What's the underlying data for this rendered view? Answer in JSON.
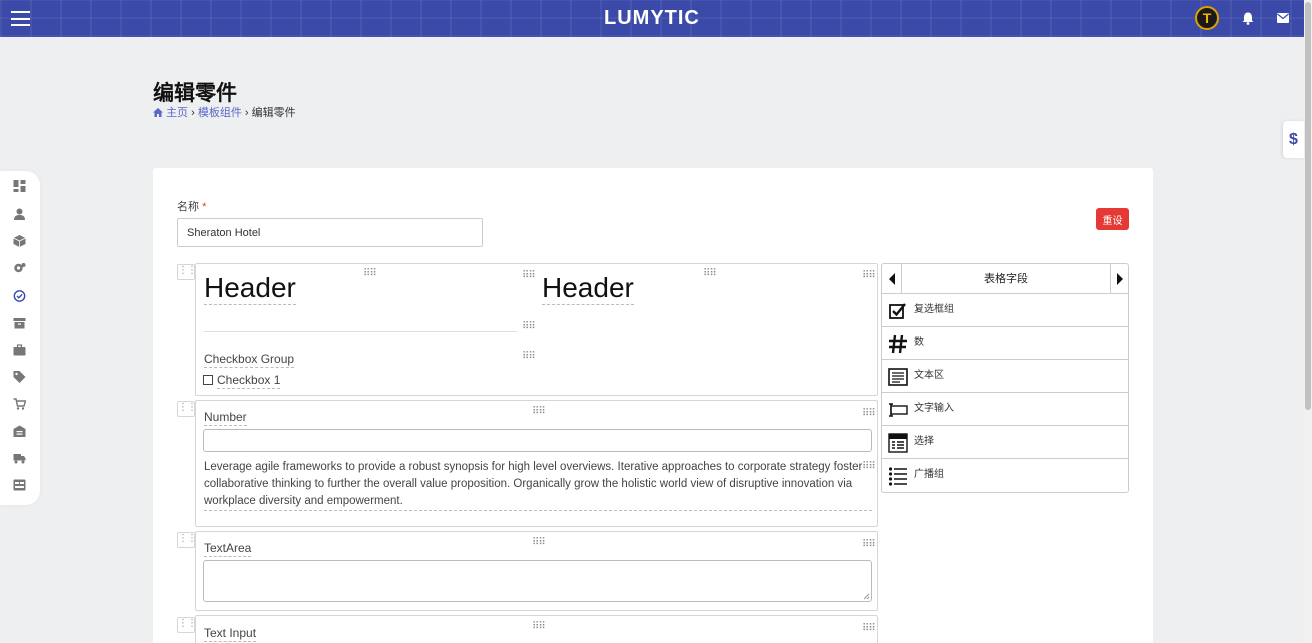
{
  "topbar": {
    "logo": "LUMYTIC",
    "avatar_initial": "T"
  },
  "page": {
    "title": "编辑零件",
    "breadcrumb": {
      "home": "主页",
      "sep1": "›",
      "parent": "模板组件",
      "sep2": "›",
      "current": "编辑零件"
    }
  },
  "form": {
    "name_label": "名称",
    "required_mark": "*",
    "name_value": "Sheraton Hotel",
    "reset_label": "重设"
  },
  "builder": {
    "header_1": "Header",
    "header_2": "Header",
    "checkbox_group_label": "Checkbox Group",
    "checkbox_1_label": "Checkbox 1",
    "number_label": "Number",
    "paragraph": "Leverage agile frameworks to provide a robust synopsis for high level overviews. Iterative approaches to corporate strategy foster collaborative thinking to further the overall value proposition. Organically grow the holistic world view of disruptive innovation via workplace diversity and empowerment.",
    "textarea_label": "TextArea",
    "text_input_label": "Text Input"
  },
  "palette": {
    "title": "表格字段",
    "items": [
      {
        "label": "复选框组",
        "icon": "checkbox-icon"
      },
      {
        "label": "数",
        "icon": "hash-icon"
      },
      {
        "label": "文本区",
        "icon": "textarea-icon"
      },
      {
        "label": "文字输入",
        "icon": "text-input-icon"
      },
      {
        "label": "选择",
        "icon": "select-icon"
      },
      {
        "label": "广播组",
        "icon": "radio-list-icon"
      }
    ]
  },
  "side_tab": {
    "symbol": "$"
  },
  "colors": {
    "topbar": "#3b4aa8",
    "accent": "#5a67c9",
    "danger": "#e53935"
  }
}
